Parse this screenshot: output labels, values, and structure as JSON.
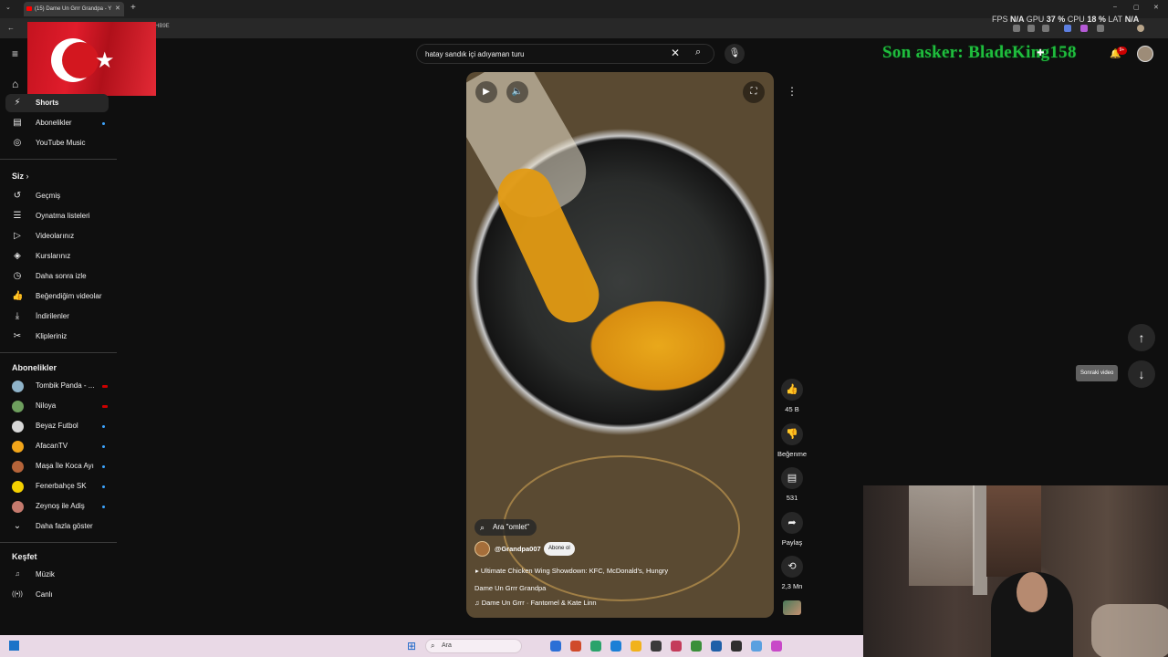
{
  "browser": {
    "tab_title": "(15) Dame Un Grrr Grandpa - Y",
    "url_fragment": "HB9E",
    "window_controls": [
      "–",
      "▢",
      "✕"
    ]
  },
  "overlay": {
    "stats": [
      {
        "label": "FPS",
        "value": "N/A"
      },
      {
        "label": "GPU",
        "value": "37 %"
      },
      {
        "label": "CPU",
        "value": "18 %"
      },
      {
        "label": "LAT",
        "value": "N/A"
      }
    ],
    "watermark": "Son asker: BladeKing158"
  },
  "header": {
    "search_value": "hatay sandık içi adıyaman turu",
    "notification_badge": "9+"
  },
  "sidebar": {
    "main": [
      {
        "label": "Shorts",
        "icon": "shorts-icon",
        "glyph": "⚡",
        "active": true
      },
      {
        "label": "Abonelikler",
        "icon": "subscriptions-icon",
        "glyph": "▤",
        "active": false,
        "dot": true
      },
      {
        "label": "YouTube Music",
        "icon": "music-icon",
        "glyph": "◎",
        "active": false
      }
    ],
    "you_header": "Siz",
    "you": [
      {
        "label": "Geçmiş",
        "icon": "history-icon",
        "glyph": "↺"
      },
      {
        "label": "Oynatma listeleri",
        "icon": "playlists-icon",
        "glyph": "☰"
      },
      {
        "label": "Videolarınız",
        "icon": "your-videos-icon",
        "glyph": "▷"
      },
      {
        "label": "Kurslarınız",
        "icon": "courses-icon",
        "glyph": "◈"
      },
      {
        "label": "Daha sonra izle",
        "icon": "watch-later-icon",
        "glyph": "◷"
      },
      {
        "label": "Beğendiğim videolar",
        "icon": "liked-icon",
        "glyph": "👍"
      },
      {
        "label": "İndirilenler",
        "icon": "download-icon",
        "glyph": "⤓"
      },
      {
        "label": "Klipleriniz",
        "icon": "clips-icon",
        "glyph": "✂"
      }
    ],
    "subs_header": "Abonelikler",
    "subscriptions": [
      {
        "label": "Tombik Panda - ...",
        "color": "#8fb3c9",
        "live": true
      },
      {
        "label": "Niloya",
        "color": "#6e9f5e",
        "live": true
      },
      {
        "label": "Beyaz Futbol",
        "color": "#d8d8d8",
        "live": false
      },
      {
        "label": "AfacanTV",
        "color": "#f2a51a",
        "live": false
      },
      {
        "label": "Maşa İle Koca Ayı",
        "color": "#b5643a",
        "live": false
      },
      {
        "label": "Fenerbahçe SK",
        "color": "#f4d000",
        "live": false
      },
      {
        "label": "Zeynoş ile Adiş",
        "color": "#c57a6e",
        "live": false
      }
    ],
    "show_more": "Daha fazla göster",
    "explore_header": "Keşfet",
    "explore": [
      {
        "label": "Müzik",
        "icon": "music-note-icon",
        "glyph": "♫"
      },
      {
        "label": "Canlı",
        "icon": "live-icon",
        "glyph": "((•))"
      }
    ]
  },
  "short": {
    "search_chip": "Ara \"omlet\"",
    "channel": "@Grandpa007",
    "subscribe_label": "Abone ol",
    "related_video": "Ultimate Chicken Wing Showdown: KFC, McDonald's, Hungry",
    "title": "Dame Un Grrr Grandpa",
    "audio": "Dame Un Grrr · Fantomel & Kate Linn"
  },
  "actions": {
    "likes": "45 B",
    "dislike_label": "Beğenme",
    "comments": "531",
    "share_label": "Paylaş",
    "remix_count": "2,3 Mn"
  },
  "nav": {
    "tooltip": "Sonraki video"
  },
  "taskbar": {
    "search_placeholder": "Ara",
    "app_colors": [
      "#2b6fd6",
      "#d04a2a",
      "#2aa36b",
      "#1b7fd6",
      "#f1b21b",
      "#3a3a3a",
      "#c43b5a",
      "#3a8f3a",
      "#1f5fa8",
      "#2f2f2f",
      "#5aa0e0",
      "#c848c8"
    ]
  }
}
